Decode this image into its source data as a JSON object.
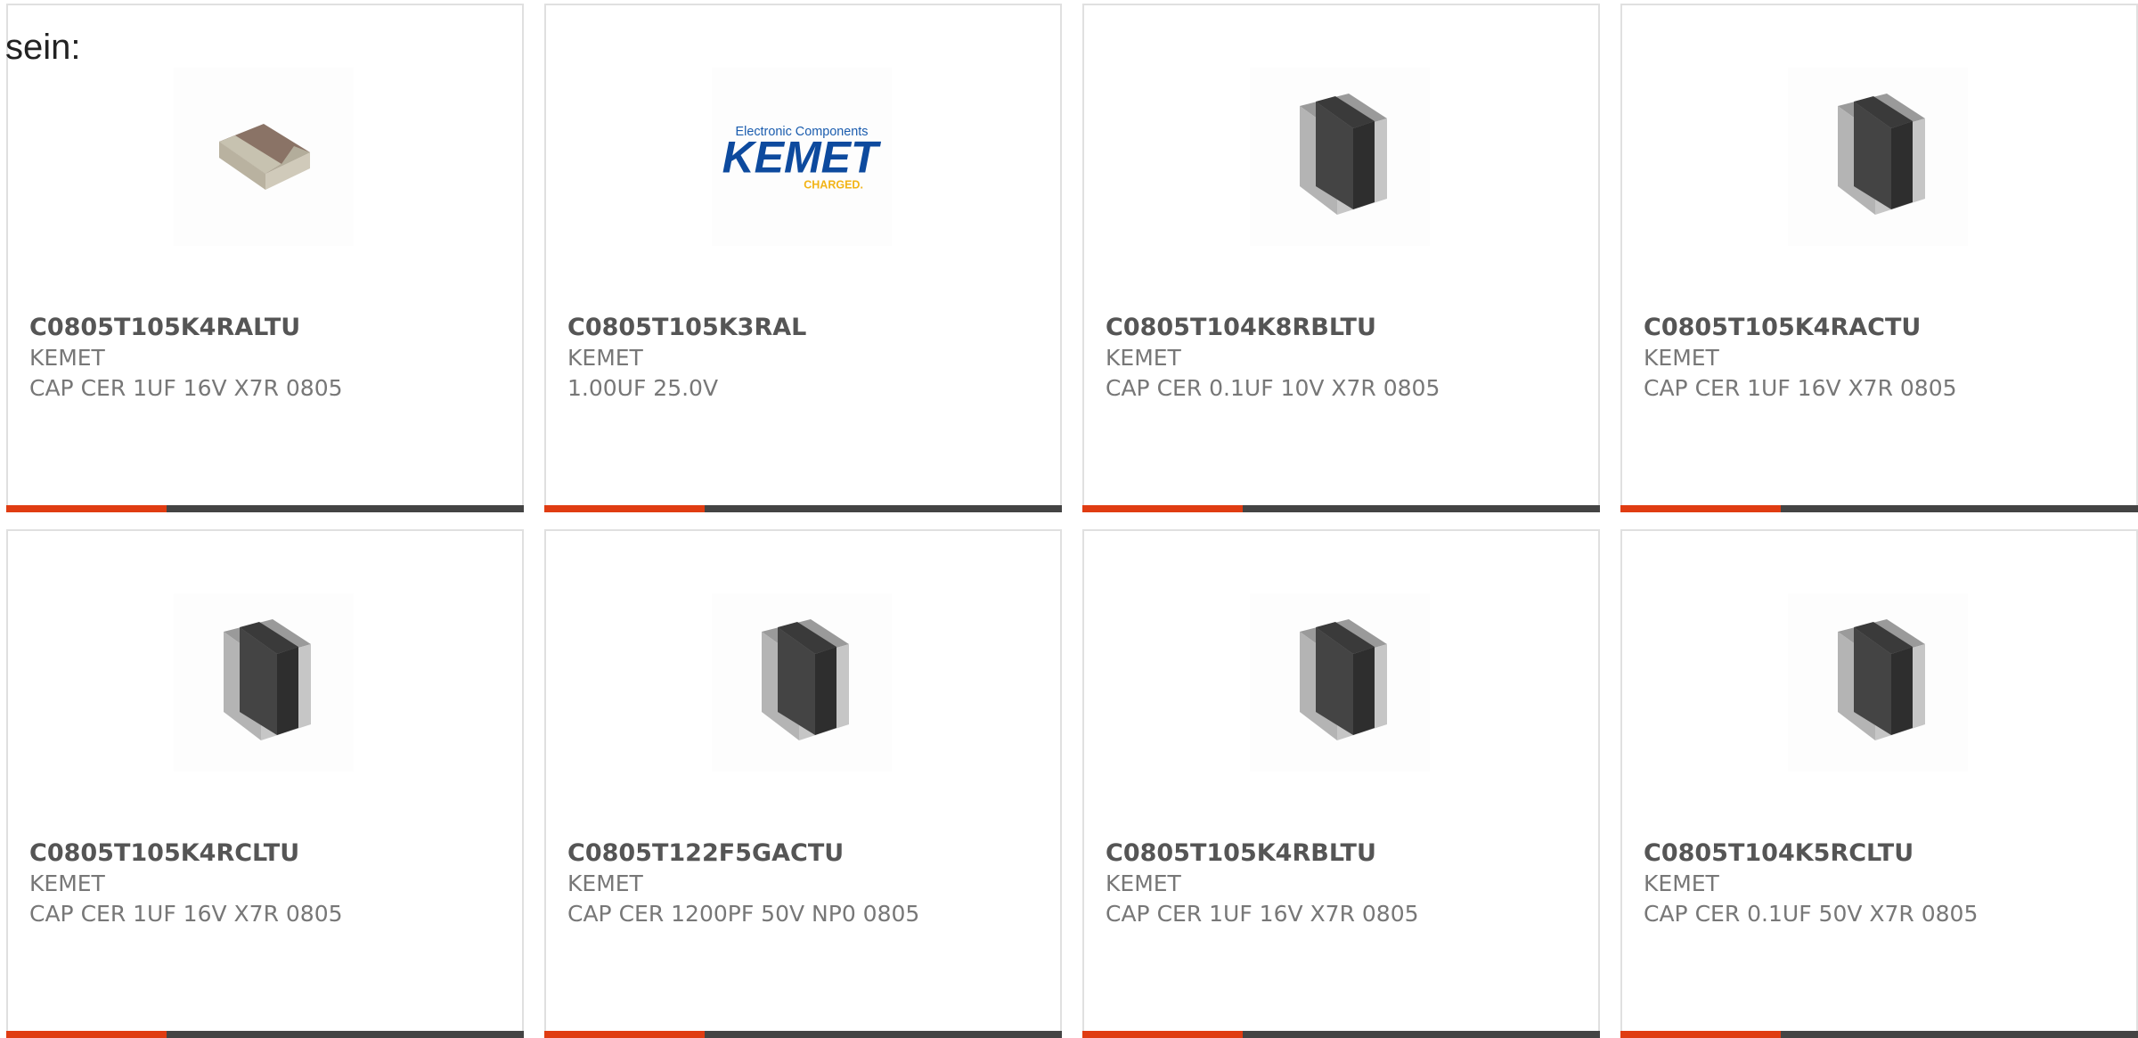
{
  "intro_text": "sein:",
  "colors": {
    "accent": "#e03c12",
    "bar_track": "#444444",
    "card_border": "#e0e0e0",
    "part_text": "#555555",
    "meta_text": "#777777"
  },
  "products": [
    {
      "part": "C0805T105K4RALTU",
      "mfr": "KEMET",
      "desc": "CAP CER 1UF 16V X7R 0805",
      "image": "mlcc-chip-brown",
      "accent_fraction": 0.31
    },
    {
      "part": "C0805T105K3RAL",
      "mfr": "KEMET",
      "desc": "1.00UF 25.0V",
      "image": "kemet-logo",
      "logo_top": "Electronic Components",
      "logo_main": "KEMET",
      "logo_sub": "CHARGED.",
      "accent_fraction": 0.31
    },
    {
      "part": "C0805T104K8RBLTU",
      "mfr": "KEMET",
      "desc": "CAP CER 0.1UF 10V X7R 0805",
      "image": "mlcc-chip-gray",
      "accent_fraction": 0.31
    },
    {
      "part": "C0805T105K4RACTU",
      "mfr": "KEMET",
      "desc": "CAP CER 1UF 16V X7R 0805",
      "image": "mlcc-chip-gray",
      "accent_fraction": 0.31
    },
    {
      "part": "C0805T105K4RCLTU",
      "mfr": "KEMET",
      "desc": "CAP CER 1UF 16V X7R 0805",
      "image": "mlcc-chip-gray",
      "accent_fraction": 0.31
    },
    {
      "part": "C0805T122F5GACTU",
      "mfr": "KEMET",
      "desc": "CAP CER 1200PF 50V NP0 0805",
      "image": "mlcc-chip-gray",
      "accent_fraction": 0.31
    },
    {
      "part": "C0805T105K4RBLTU",
      "mfr": "KEMET",
      "desc": "CAP CER 1UF 16V X7R 0805",
      "image": "mlcc-chip-gray",
      "accent_fraction": 0.31
    },
    {
      "part": "C0805T104K5RCLTU",
      "mfr": "KEMET",
      "desc": "CAP CER 0.1UF 50V X7R 0805",
      "image": "mlcc-chip-gray",
      "accent_fraction": 0.31
    }
  ]
}
